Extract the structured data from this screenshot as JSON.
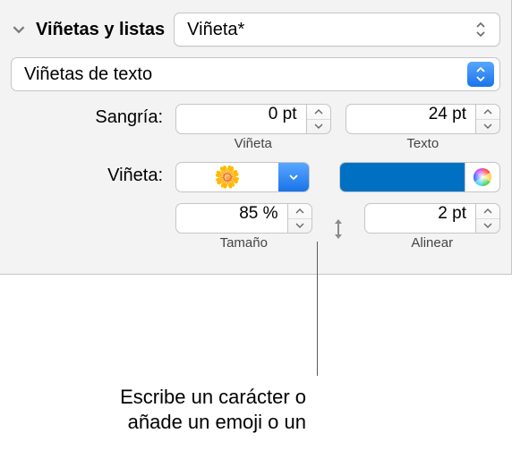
{
  "header": {
    "title": "Viñetas y listas",
    "style_value": "Viñeta*"
  },
  "list_type": {
    "value": "Viñetas de texto"
  },
  "indent": {
    "label": "Sangría:",
    "bullet_value": "0 pt",
    "bullet_sublabel": "Viñeta",
    "text_value": "24 pt",
    "text_sublabel": "Texto"
  },
  "bullet": {
    "label": "Viñeta:",
    "glyph": "🌼",
    "color": "#0071c2"
  },
  "size_align": {
    "size_value": "85 %",
    "size_sublabel": "Tamaño",
    "align_value": "2 pt",
    "align_sublabel": "Alinear"
  },
  "callout": {
    "line1": "Escribe un carácter o",
    "line2": "añade un emoji o un"
  }
}
